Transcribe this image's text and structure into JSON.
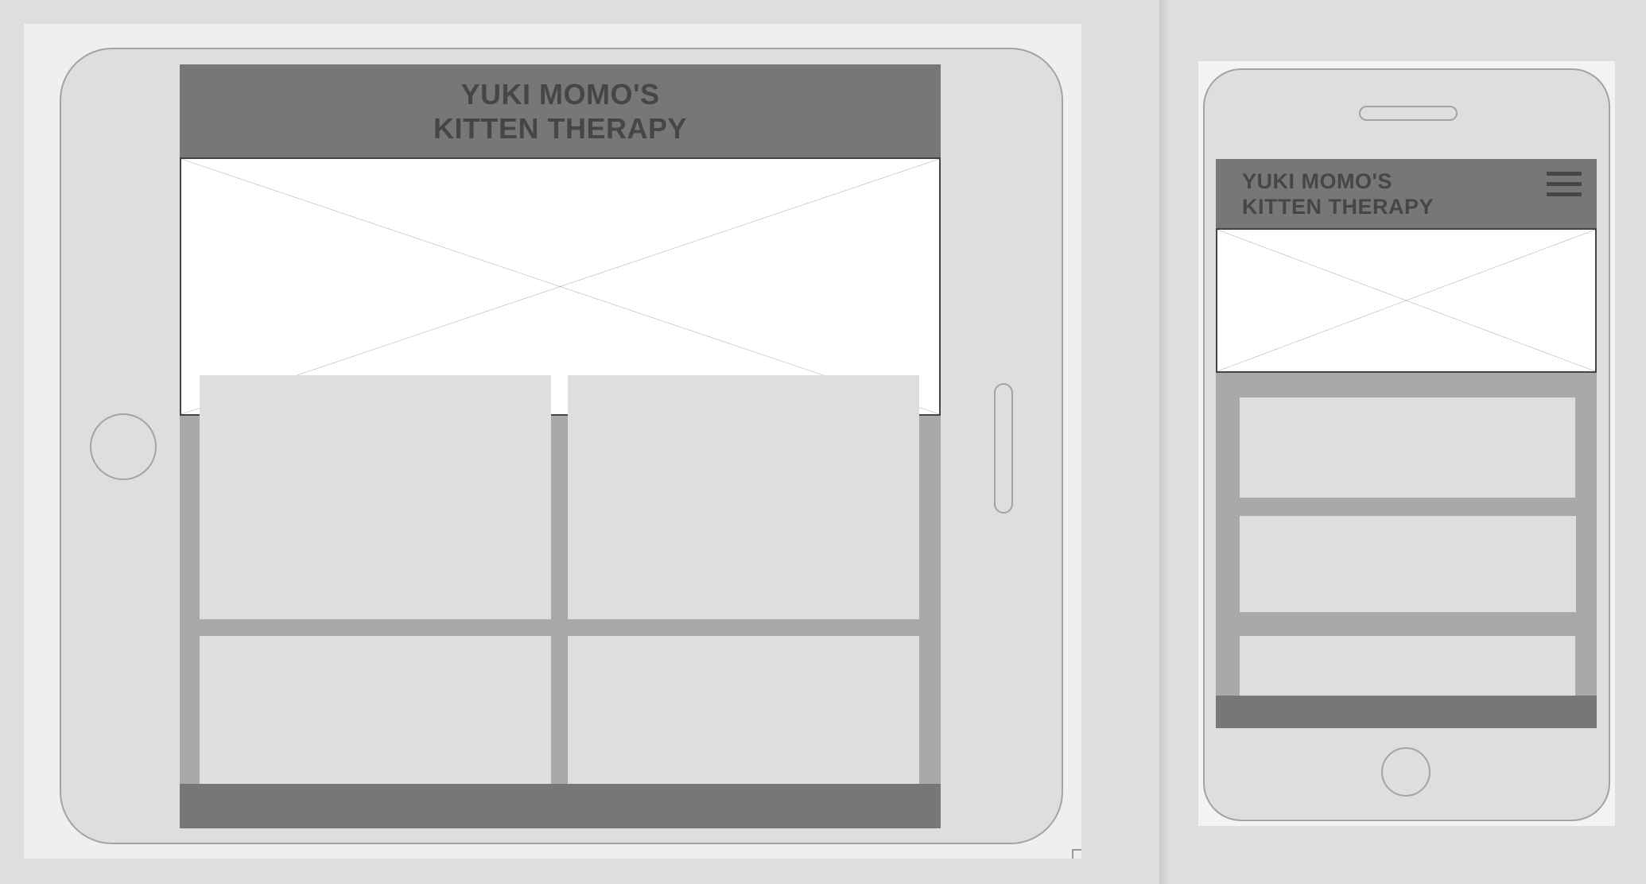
{
  "tablet": {
    "header_title": "YUKI MOMO'S\nKITTEN THERAPY",
    "image_placeholder": "image-placeholder-icon",
    "cards": 4
  },
  "phone": {
    "header_title": "YUKI MOMO'S\nKITTEN THERAPY",
    "menu_icon": "hamburger-icon",
    "image_placeholder": "image-placeholder-icon",
    "cards": 3
  },
  "colors": {
    "header_bg": "#777777",
    "header_text": "#464646",
    "content_bg": "#a9a9a9",
    "card_bg": "#dedede",
    "device_border": "#a3a3a3"
  }
}
